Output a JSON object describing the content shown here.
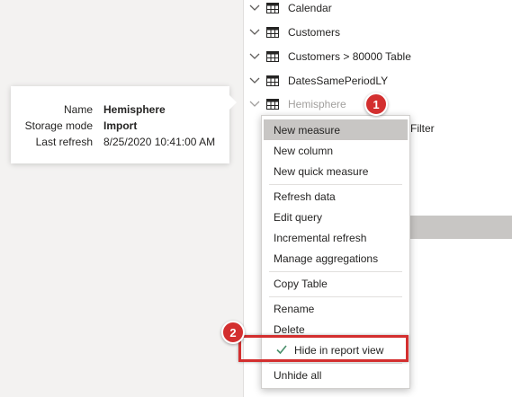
{
  "fields": {
    "tables": [
      {
        "label": "Calendar"
      },
      {
        "label": "Customers"
      },
      {
        "label": "Customers > 80000 Table"
      },
      {
        "label": "DatesSamePeriodLY"
      },
      {
        "label": "Hemisphere"
      }
    ],
    "filter_label": "Filter"
  },
  "tooltip": {
    "rows": [
      {
        "key": "Name",
        "value": "Hemisphere"
      },
      {
        "key": "Storage mode",
        "value": "Import"
      },
      {
        "key": "Last refresh",
        "value": "8/25/2020 10:41:00 AM"
      }
    ]
  },
  "context_menu": {
    "items": {
      "new_measure": "New measure",
      "new_column": "New column",
      "new_quick_measure": "New quick measure",
      "refresh_data": "Refresh data",
      "edit_query": "Edit query",
      "incremental_refresh": "Incremental refresh",
      "manage_aggregations": "Manage aggregations",
      "copy_table": "Copy Table",
      "rename": "Rename",
      "delete": "Delete",
      "hide_in_report_view": "Hide in report view",
      "unhide_all": "Unhide all"
    },
    "checked_item": "hide_in_report_view",
    "check_icon": "checkmark-icon"
  },
  "annotations": {
    "step1": "1",
    "step2": "2",
    "accent_color": "#d32f2f"
  }
}
